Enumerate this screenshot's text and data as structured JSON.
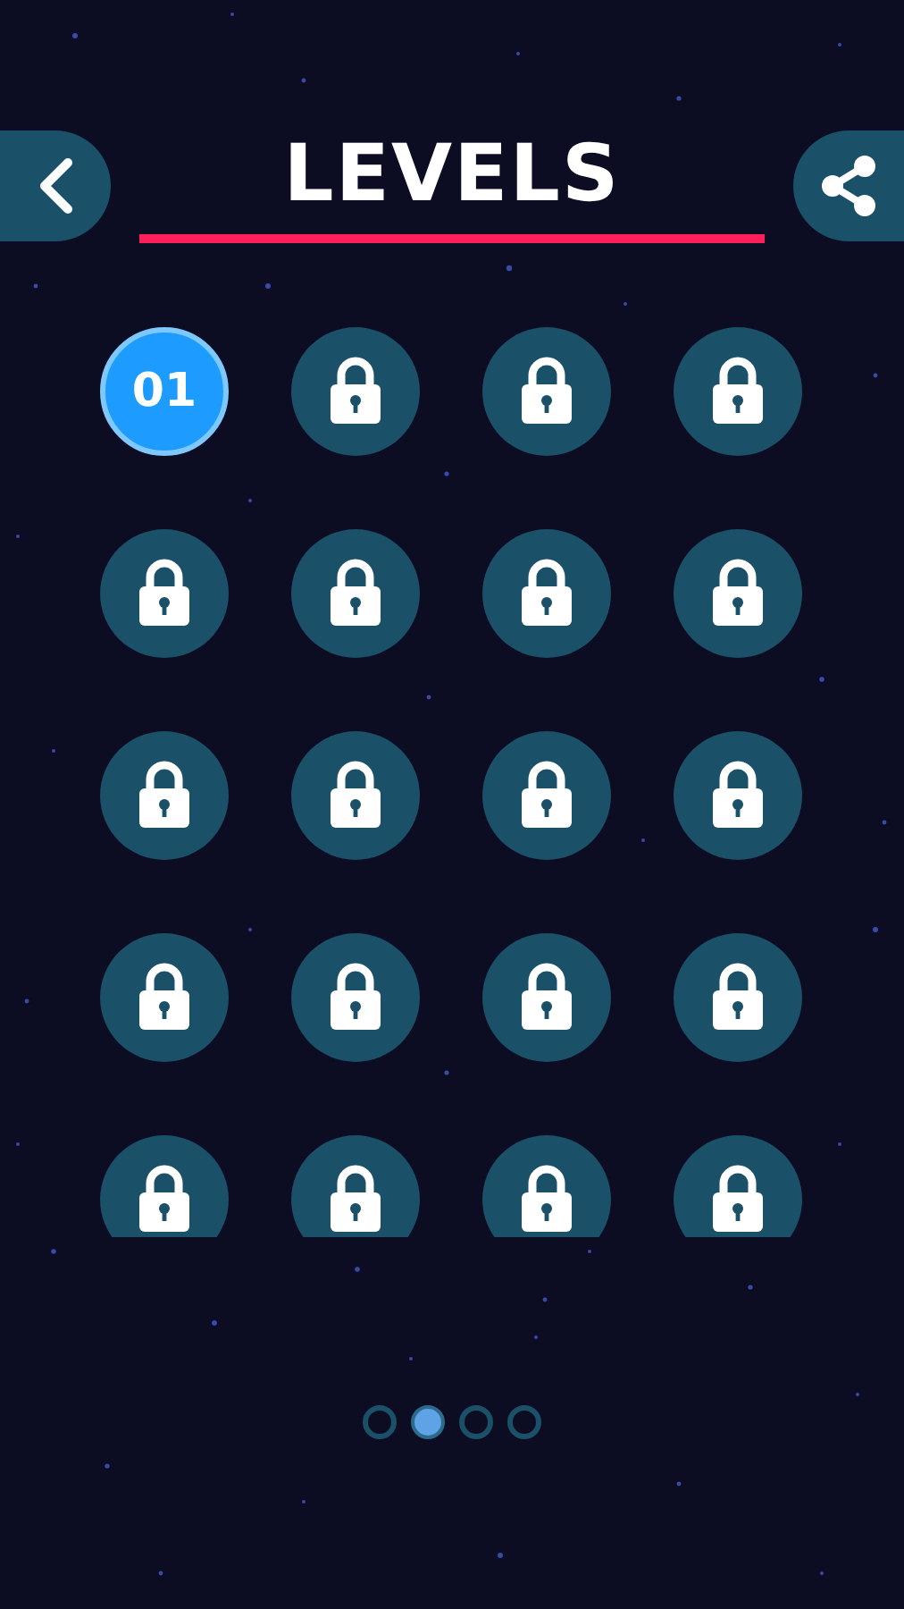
{
  "header": {
    "title": "LEVELS"
  },
  "levels": [
    {
      "label": "01",
      "locked": false
    },
    {
      "locked": true
    },
    {
      "locked": true
    },
    {
      "locked": true
    },
    {
      "locked": true
    },
    {
      "locked": true
    },
    {
      "locked": true
    },
    {
      "locked": true
    },
    {
      "locked": true
    },
    {
      "locked": true
    },
    {
      "locked": true
    },
    {
      "locked": true
    },
    {
      "locked": true
    },
    {
      "locked": true
    },
    {
      "locked": true
    },
    {
      "locked": true
    },
    {
      "locked": true
    },
    {
      "locked": true
    },
    {
      "locked": true
    },
    {
      "locked": true
    }
  ],
  "pages": [
    {
      "selected": false
    },
    {
      "selected": true
    },
    {
      "selected": false
    },
    {
      "selected": false
    }
  ]
}
